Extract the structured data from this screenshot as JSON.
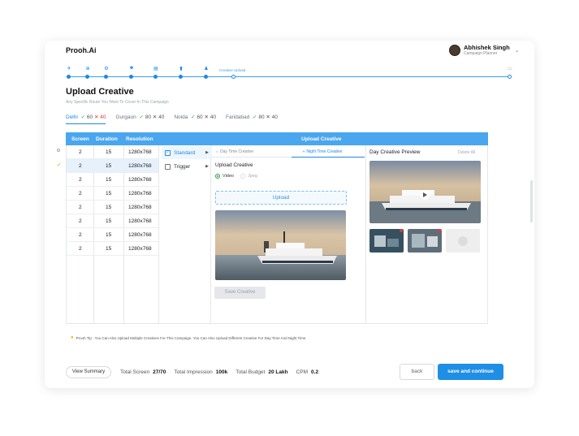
{
  "brand": "Prooh.Ai",
  "user": {
    "name": "Abhishek Singh",
    "role": "Campaign Planner"
  },
  "stepper": {
    "current_label": "Creative Upload"
  },
  "page": {
    "title": "Upload Creative",
    "subtitle": "Any Specific Route You Want To Cover In This Campaign"
  },
  "cities": [
    {
      "name": "Delhi",
      "ok": "✓",
      "count": "60",
      "x": "✕",
      "x_count": "40"
    },
    {
      "name": "Gurgaon",
      "ok": "✓",
      "count": "80",
      "x": "✕",
      "x_count": "40"
    },
    {
      "name": "Noida",
      "ok": "✓",
      "count": "60",
      "x": "✕",
      "x_count": "40"
    },
    {
      "name": "Faridabad",
      "ok": "✓",
      "count": "80",
      "x": "✕",
      "x_count": "40"
    }
  ],
  "table": {
    "headers": {
      "screen": "Screen",
      "duration": "Duration",
      "resolution": "Resolution",
      "upload": "Upload Creative"
    },
    "rows": [
      {
        "screen": "2",
        "duration": "15",
        "resolution": "1280x768"
      },
      {
        "screen": "2",
        "duration": "15",
        "resolution": "1280x768"
      },
      {
        "screen": "2",
        "duration": "15",
        "resolution": "1280x768"
      },
      {
        "screen": "2",
        "duration": "15",
        "resolution": "1280x768"
      },
      {
        "screen": "2",
        "duration": "15",
        "resolution": "1280x768"
      },
      {
        "screen": "2",
        "duration": "15",
        "resolution": "1280x768"
      },
      {
        "screen": "2",
        "duration": "15",
        "resolution": "1280x768"
      },
      {
        "screen": "2",
        "duration": "15",
        "resolution": "1280x768"
      }
    ],
    "types": [
      {
        "label": "Standard",
        "checked": "✓"
      },
      {
        "label": "Trigger",
        "checked": ""
      }
    ]
  },
  "upload": {
    "tabs": {
      "day": "Day Time Creative",
      "night": "Night Time Creative"
    },
    "title": "Upload Creative",
    "radio": {
      "video": "Video",
      "jpeg": "Jpeg"
    },
    "upload_button": "Upload",
    "save_button": "Save Creative"
  },
  "preview": {
    "title": "Day Creative Preview",
    "delete_all": "Delete All"
  },
  "tip": "Prooh Tip : You Can Also Upload Multiple Creatives For This Campaign. You Can Also Upload Different Creative For Day Time And Night Time",
  "footer": {
    "view_summary": "View Summary",
    "total_screen_label": "Total Screen",
    "total_screen_value": "27/70",
    "total_impression_label": "Total Impression",
    "total_impression_value": "100k",
    "total_budget_label": "Total Budget",
    "total_budget_value": "20 Lakh",
    "cpm_label": "CPM",
    "cpm_value": "0.2",
    "back": "back",
    "save_continue": "save and continue"
  },
  "colors": {
    "accent": "#1e88e5",
    "header": "#4aa6ee",
    "success": "#22a447",
    "danger": "#e53935"
  }
}
